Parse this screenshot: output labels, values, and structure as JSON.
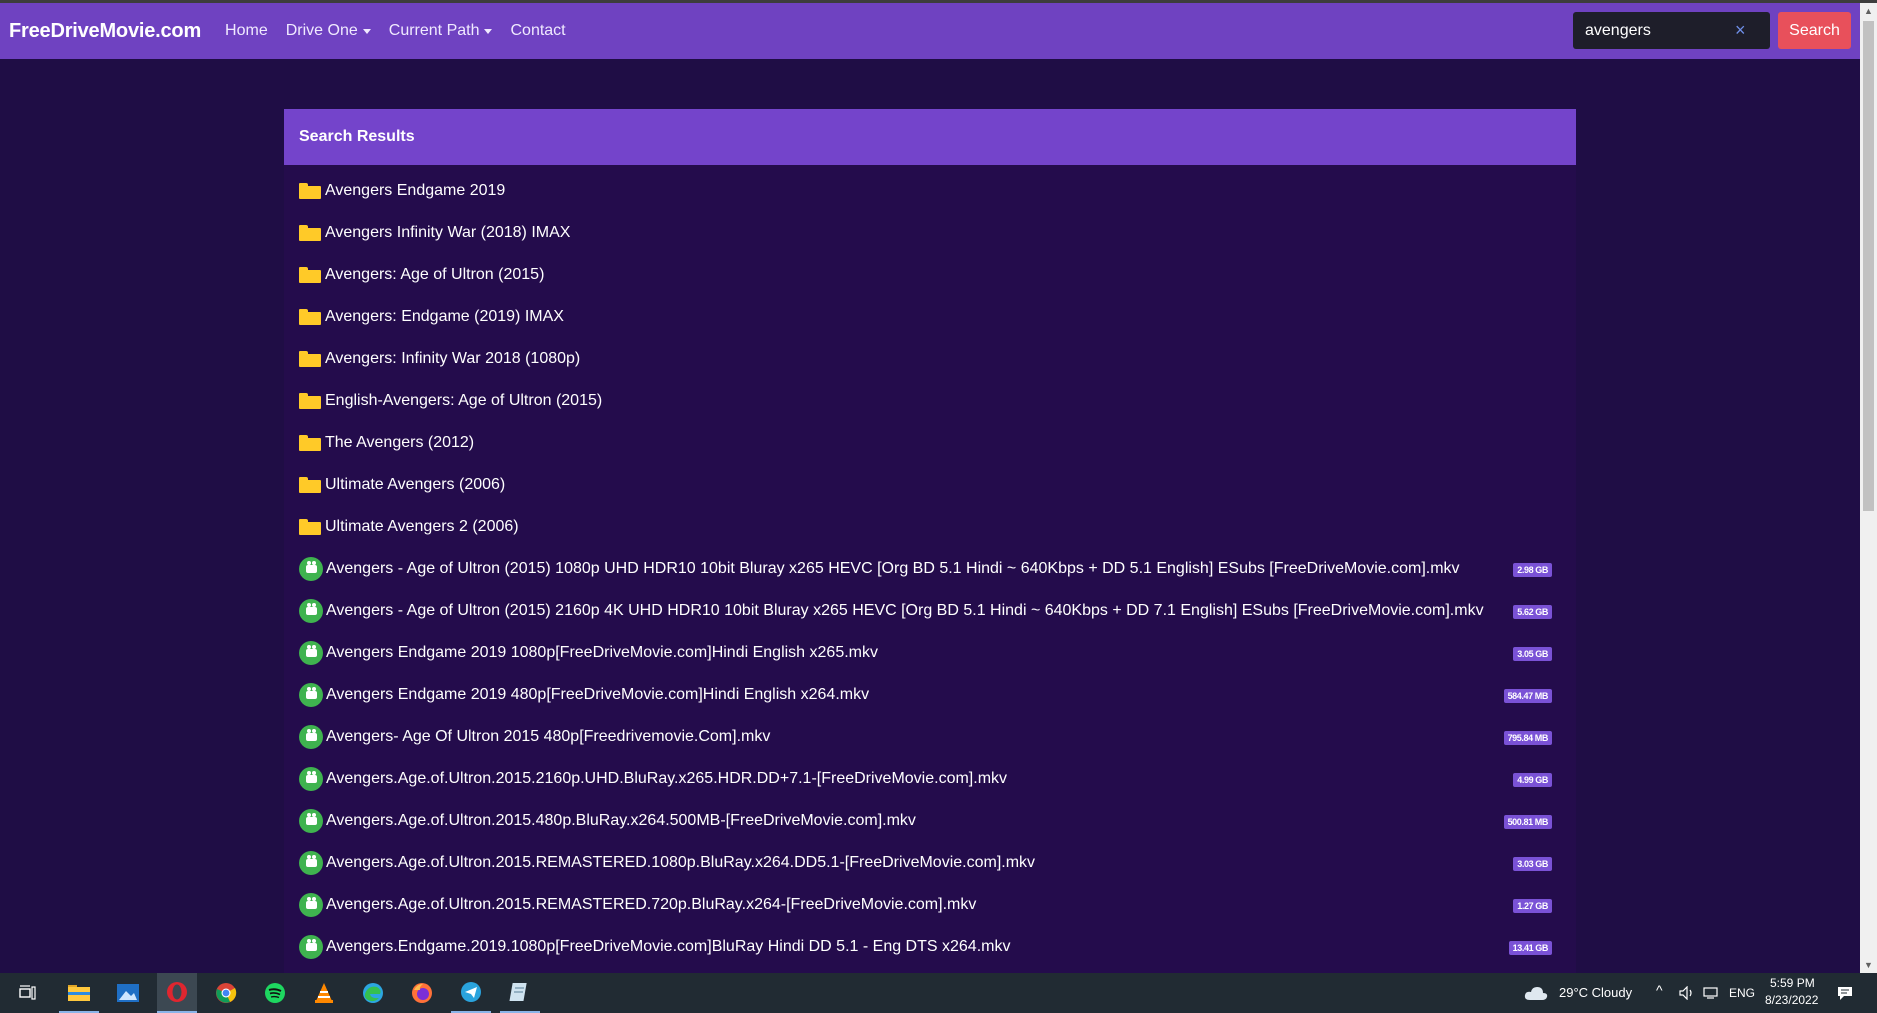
{
  "navbar": {
    "brand": "FreeDriveMovie.com",
    "links": [
      "Home",
      "Drive One",
      "Current Path",
      "Contact"
    ],
    "search_value": "avengers",
    "search_button": "Search",
    "clear_glyph": "×",
    "accent_color": "#6f42c1",
    "search_button_color": "#e8505b"
  },
  "results": {
    "header": "Search Results",
    "folders": [
      "Avengers Endgame 2019",
      "Avengers Infinity War (2018) IMAX",
      "Avengers: Age of Ultron (2015)",
      "Avengers: Endgame (2019) IMAX",
      "Avengers: Infinity War 2018 (1080p)",
      "English-Avengers: Age of Ultron (2015)",
      "The Avengers (2012)",
      "Ultimate Avengers (2006)",
      "Ultimate Avengers 2 (2006)"
    ],
    "files": [
      {
        "name": "Avengers - Age of Ultron (2015) 1080p UHD HDR10 10bit Bluray x265 HEVC [Org BD 5.1 Hindi ~ 640Kbps + DD 5.1 English] ESubs [FreeDriveMovie.com].mkv",
        "size": "2.98 GB"
      },
      {
        "name": "Avengers - Age of Ultron (2015) 2160p 4K UHD HDR10 10bit Bluray x265 HEVC [Org BD 5.1 Hindi ~ 640Kbps + DD 7.1 English] ESubs [FreeDriveMovie.com].mkv",
        "size": "5.62 GB"
      },
      {
        "name": "Avengers Endgame 2019 1080p[FreeDriveMovie.com]Hindi English x265.mkv",
        "size": "3.05 GB"
      },
      {
        "name": "Avengers Endgame 2019 480p[FreeDriveMovie.com]Hindi English x264.mkv",
        "size": "584.47 MB"
      },
      {
        "name": "Avengers- Age Of Ultron 2015 480p[Freedrivemovie.Com].mkv",
        "size": "795.84 MB"
      },
      {
        "name": "Avengers.Age.of.Ultron.2015.2160p.UHD.BluRay.x265.HDR.DD+7.1-[FreeDriveMovie.com].mkv",
        "size": "4.99 GB"
      },
      {
        "name": "Avengers.Age.of.Ultron.2015.480p.BluRay.x264.500MB-[FreeDriveMovie.com].mkv",
        "size": "500.81 MB"
      },
      {
        "name": "Avengers.Age.of.Ultron.2015.REMASTERED.1080p.BluRay.x264.DD5.1-[FreeDriveMovie.com].mkv",
        "size": "3.03 GB"
      },
      {
        "name": "Avengers.Age.of.Ultron.2015.REMASTERED.720p.BluRay.x264-[FreeDriveMovie.com].mkv",
        "size": "1.27 GB"
      },
      {
        "name": "Avengers.Endgame.2019.1080p[FreeDriveMovie.com]BluRay Hindi DD 5.1 - Eng DTS x264.mkv",
        "size": "13.41 GB"
      }
    ]
  },
  "taskbar": {
    "apps": [
      "task-view-icon",
      "file-explorer-icon",
      "photos-icon",
      "opera-icon",
      "chrome-icon",
      "spotify-icon",
      "vlc-icon",
      "edge-icon",
      "firefox-icon",
      "telegram-icon",
      "notepad-icon"
    ],
    "weather": "29°C  Cloudy",
    "language": "ENG",
    "time": "5:59 PM",
    "date": "8/23/2022"
  }
}
